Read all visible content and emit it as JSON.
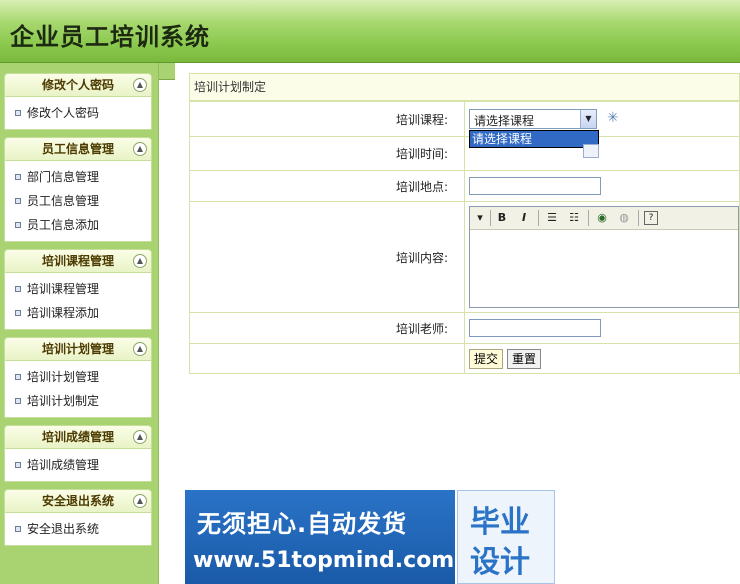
{
  "app_title": "企业员工培训系统",
  "sidebar": {
    "groups": [
      {
        "title": "修改个人密码",
        "items": [
          "修改个人密码"
        ]
      },
      {
        "title": "员工信息管理",
        "items": [
          "部门信息管理",
          "员工信息管理",
          "员工信息添加"
        ]
      },
      {
        "title": "培训课程管理",
        "items": [
          "培训课程管理",
          "培训课程添加"
        ]
      },
      {
        "title": "培训计划管理",
        "items": [
          "培训计划管理",
          "培训计划制定"
        ]
      },
      {
        "title": "培训成绩管理",
        "items": [
          "培训成绩管理"
        ]
      },
      {
        "title": "安全退出系统",
        "items": [
          "安全退出系统"
        ]
      }
    ]
  },
  "form": {
    "title": "培训计划制定",
    "course_label": "培训课程:",
    "course_selected": "请选择课程",
    "course_options": [
      "请选择课程"
    ],
    "time_label": "培训时间:",
    "place_label": "培训地点:",
    "content_label": "培训内容:",
    "teacher_label": "培训老师:",
    "submit_label": "提交",
    "reset_label": "重置"
  },
  "editor_toolbar": {
    "bold": "B",
    "italic": "I"
  },
  "ad": {
    "line1": "无须担心.自动发货",
    "line2": "www.51topmind.com",
    "right_top": "毕业",
    "right_bottom": "设计"
  }
}
